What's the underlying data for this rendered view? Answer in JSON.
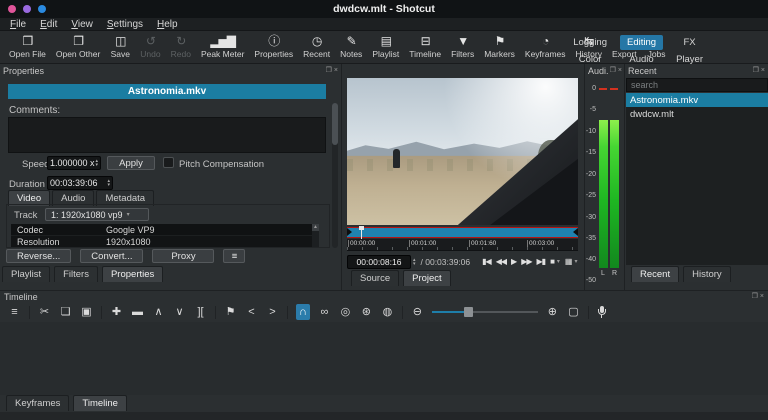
{
  "window": {
    "title": "dwdcw.mlt - Shotcut",
    "dot_colors": [
      "#e0559a",
      "#9a6ae0",
      "#2a8ae0"
    ]
  },
  "menubar": [
    "File",
    "Edit",
    "View",
    "Settings",
    "Help"
  ],
  "toolbar": {
    "items": [
      {
        "label": "Open File",
        "icon": "open-file",
        "glyph": "❒"
      },
      {
        "label": "Open Other",
        "icon": "open-other",
        "glyph": "❐"
      },
      {
        "label": "Save",
        "icon": "save",
        "glyph": "◫"
      },
      {
        "label": "Undo",
        "icon": "undo",
        "glyph": "↺"
      },
      {
        "label": "Redo",
        "icon": "redo",
        "glyph": "↻"
      },
      {
        "label": "Peak Meter",
        "icon": "peak-meter",
        "glyph": "▂▅▇"
      },
      {
        "label": "Properties",
        "icon": "properties",
        "glyph": "ⓘ"
      },
      {
        "label": "Recent",
        "icon": "recent",
        "glyph": "◷"
      },
      {
        "label": "Notes",
        "icon": "notes",
        "glyph": "✎"
      },
      {
        "label": "Playlist",
        "icon": "playlist",
        "glyph": "▤"
      },
      {
        "label": "Timeline",
        "icon": "timeline",
        "glyph": "⊟"
      },
      {
        "label": "Filters",
        "icon": "filters",
        "glyph": "▼"
      },
      {
        "label": "Markers",
        "icon": "markers",
        "glyph": "⚑"
      },
      {
        "label": "Keyframes",
        "icon": "keyframes",
        "glyph": "◔"
      },
      {
        "label": "History",
        "icon": "history",
        "glyph": "↹"
      },
      {
        "label": "Export",
        "icon": "export",
        "glyph": "◉"
      },
      {
        "label": "Jobs",
        "icon": "jobs",
        "glyph": "≣"
      }
    ],
    "layout_buttons": [
      "Logging",
      "Editing",
      "FX",
      "Color",
      "Audio",
      "Player"
    ],
    "active_layout": "Editing"
  },
  "icons": {
    "float": "❐",
    "close": "×",
    "spin_up": "▲",
    "spin_down": "▼",
    "dropdown": "▾",
    "menu": "≡",
    "scroll_up": "▲"
  },
  "properties": {
    "title": "Properties",
    "clip_name": "Astronomia.mkv",
    "comments_label": "Comments:",
    "speed_label": "Speed",
    "speed_value": "1.000000 x",
    "apply_label": "Apply",
    "pitch_label": "Pitch Compensation",
    "duration_label": "Duration",
    "duration_value": "00:03:39:06",
    "tabs": [
      "Video",
      "Audio",
      "Metadata"
    ],
    "active_tab": "Video",
    "track_label": "Track",
    "track_value": "1: 1920x1080 vp9",
    "table": [
      {
        "key": "Codec",
        "value": "Google VP9"
      },
      {
        "key": "Resolution",
        "value": "1920x1080"
      }
    ],
    "buttons": [
      "Reverse...",
      "Convert...",
      "Proxy"
    ],
    "bottom_tabs": [
      "Playlist",
      "Filters",
      "Properties"
    ],
    "active_bottom_tab": "Properties"
  },
  "player": {
    "ruler_labels": [
      "00:00:00",
      "00:01:00",
      "00:01:60",
      "00:03:00"
    ],
    "current_time": "00:00:08:16",
    "total_display": "/ 00:03:39:06",
    "transport": [
      {
        "name": "skip-to-start",
        "glyph": "▮◀"
      },
      {
        "name": "rewind",
        "glyph": "◀◀"
      },
      {
        "name": "play",
        "glyph": "▶"
      },
      {
        "name": "fast-forward",
        "glyph": "▶▶"
      },
      {
        "name": "skip-to-end",
        "glyph": "▶▮"
      },
      {
        "name": "zoom-fit",
        "glyph": "■"
      },
      {
        "name": "grid",
        "glyph": "▦"
      }
    ],
    "tabs": [
      "Source",
      "Project"
    ],
    "active_tab": "Project",
    "colors": {
      "scrub_blue": "#1f82b0",
      "trim_red": "#b51414"
    }
  },
  "audio_meter": {
    "title": "Audi...",
    "scale": [
      "0",
      "-5",
      "-10",
      "-15",
      "-20",
      "-25",
      "-30",
      "-35",
      "-40",
      "-50"
    ],
    "channels": [
      "L",
      "R"
    ],
    "colors": {
      "green_top": "#8df04c",
      "green_bottom": "#12881e",
      "peak_red": "#d23220"
    }
  },
  "recent": {
    "title": "Recent",
    "search_placeholder": "search",
    "items": [
      "Astronomia.mkv",
      "dwdcw.mlt"
    ],
    "selected_item": "Astronomia.mkv",
    "bottom_tabs": [
      "Recent",
      "History"
    ],
    "active_bottom_tab": "Recent"
  },
  "timeline": {
    "title": "Timeline",
    "tools": [
      {
        "name": "timeline-menu",
        "glyph": "≡"
      },
      {
        "name": "cut",
        "glyph": "✂"
      },
      {
        "name": "copy",
        "glyph": "❏"
      },
      {
        "name": "paste",
        "glyph": "▣"
      },
      {
        "name": "append",
        "glyph": "✚"
      },
      {
        "name": "ripple-delete",
        "glyph": "▬"
      },
      {
        "name": "lift",
        "glyph": "∧"
      },
      {
        "name": "overwrite",
        "glyph": "∨"
      },
      {
        "name": "split",
        "glyph": "]["
      },
      {
        "name": "marker",
        "glyph": "⚑"
      },
      {
        "name": "prev-marker",
        "glyph": "<"
      },
      {
        "name": "next-marker",
        "glyph": ">"
      },
      {
        "name": "snap",
        "glyph": "∩",
        "active": true
      },
      {
        "name": "scrub-while-dragging",
        "glyph": "∞"
      },
      {
        "name": "ripple",
        "glyph": "◎"
      },
      {
        "name": "ripple-all-tracks",
        "glyph": "⊛"
      },
      {
        "name": "ripple-markers",
        "glyph": "◍"
      },
      {
        "name": "zoom-out",
        "glyph": "⊖"
      },
      {
        "name": "zoom-in",
        "glyph": "⊕"
      },
      {
        "name": "zoom-fit-timeline",
        "glyph": "▢"
      },
      {
        "name": "record-audio",
        "glyph": "microphone"
      }
    ],
    "bottom_tabs": [
      "Keyframes",
      "Timeline"
    ],
    "active_bottom_tab": "Timeline",
    "snap_active_color": "#2b7cab"
  }
}
